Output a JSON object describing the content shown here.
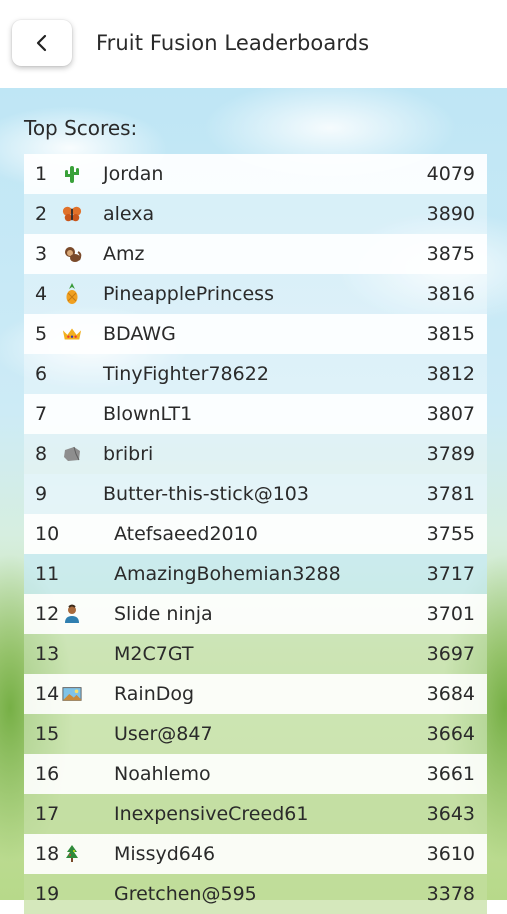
{
  "header": {
    "title": "Fruit Fusion Leaderboards"
  },
  "section": {
    "title": "Top Scores:"
  },
  "entries": [
    {
      "rank": "1",
      "icon": "cactus-icon",
      "name": "Jordan",
      "score": "4079"
    },
    {
      "rank": "2",
      "icon": "butterfly-icon",
      "name": "alexa",
      "score": "3890"
    },
    {
      "rank": "3",
      "icon": "monkey-icon",
      "name": "Amz",
      "score": "3875"
    },
    {
      "rank": "4",
      "icon": "pineapple-icon",
      "name": "PineapplePrincess",
      "score": "3816"
    },
    {
      "rank": "5",
      "icon": "crown-icon",
      "name": "BDAWG",
      "score": "3815"
    },
    {
      "rank": "6",
      "icon": "",
      "name": "TinyFighter78622",
      "score": "3812"
    },
    {
      "rank": "7",
      "icon": "",
      "name": "BlownLT1",
      "score": "3807"
    },
    {
      "rank": "8",
      "icon": "rock-icon",
      "name": "bribri",
      "score": "3789"
    },
    {
      "rank": "9",
      "icon": "",
      "name": "Butter-this-stick@103",
      "score": "3781"
    },
    {
      "rank": "10",
      "icon": "",
      "name": "Atefsaeed2010",
      "score": "3755"
    },
    {
      "rank": "11",
      "icon": "",
      "name": "AmazingBohemian3288",
      "score": "3717"
    },
    {
      "rank": "12",
      "icon": "person-icon",
      "name": "Slide ninja",
      "score": "3701"
    },
    {
      "rank": "13",
      "icon": "",
      "name": "M2C7GT",
      "score": "3697"
    },
    {
      "rank": "14",
      "icon": "picture-icon",
      "name": "RainDog",
      "score": "3684"
    },
    {
      "rank": "15",
      "icon": "",
      "name": "User@847",
      "score": "3664"
    },
    {
      "rank": "16",
      "icon": "",
      "name": "Noahlemo",
      "score": "3661"
    },
    {
      "rank": "17",
      "icon": "",
      "name": "InexpensiveCreed61",
      "score": "3643"
    },
    {
      "rank": "18",
      "icon": "tree-icon",
      "name": "Missyd646",
      "score": "3610"
    },
    {
      "rank": "19",
      "icon": "",
      "name": "Gretchen@595",
      "score": "3378"
    }
  ]
}
